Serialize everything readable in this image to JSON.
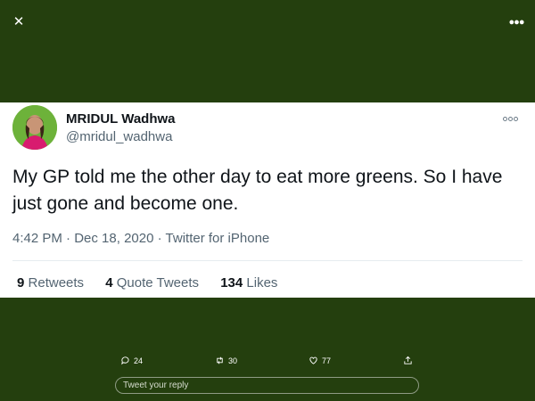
{
  "top": {
    "close_icon": "close-icon",
    "more_icon": "more-horizontal-icon"
  },
  "tweet": {
    "display_name": "MRIDUL Wadhwa",
    "handle": "@mridul_wadhwa",
    "text": "My GP told me the other day to eat more greens. So I have just gone and become one.",
    "time": "4:42 PM",
    "date": "Dec 18, 2020",
    "source": "Twitter for iPhone",
    "sep": "·"
  },
  "stats": {
    "retweets_count": "9",
    "retweets_label": "Retweets",
    "quotes_count": "4",
    "quotes_label": "Quote Tweets",
    "likes_count": "134",
    "likes_label": "Likes"
  },
  "actions": {
    "replies": "24",
    "retweets": "30",
    "likes": "77"
  },
  "reply_input": {
    "placeholder": "Tweet your reply"
  },
  "colors": {
    "background": "#243f0e",
    "card": "#ffffff",
    "secondary_text": "#536471"
  }
}
